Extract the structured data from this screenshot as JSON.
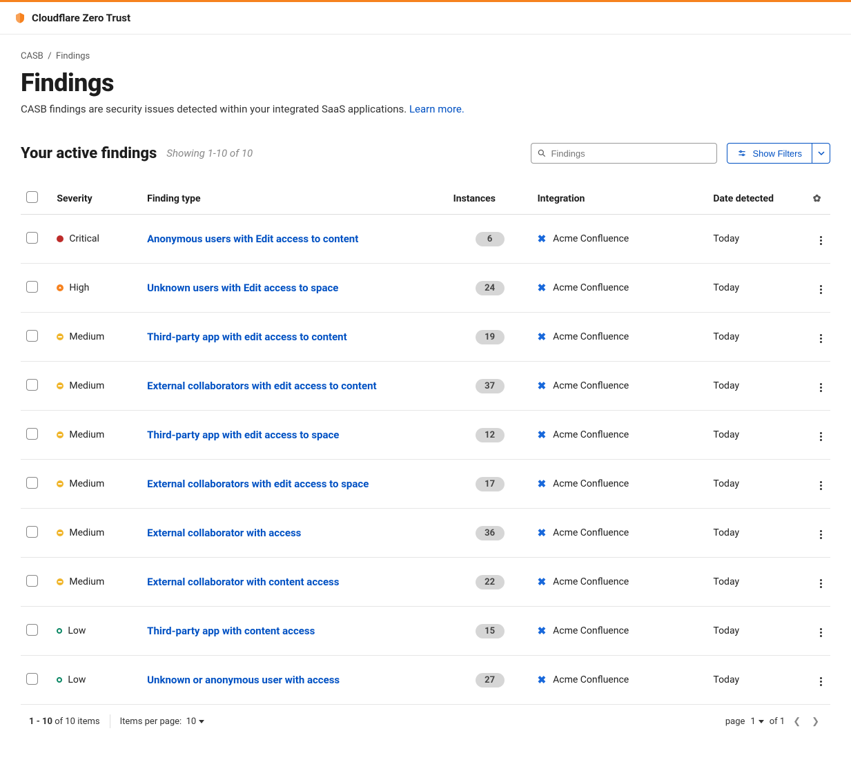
{
  "header": {
    "product": "Cloudflare Zero Trust"
  },
  "breadcrumb": {
    "root": "CASB",
    "sep": "/",
    "current": "Findings"
  },
  "page": {
    "title": "Findings",
    "description": "CASB findings are security issues detected within your integrated SaaS applications. ",
    "learn_more": "Learn more."
  },
  "subheader": {
    "title": "Your active findings",
    "showing": "Showing 1-10 of 10"
  },
  "search": {
    "placeholder": "Findings"
  },
  "filters": {
    "label": "Show Filters"
  },
  "columns": {
    "severity": "Severity",
    "type": "Finding type",
    "instances": "Instances",
    "integration": "Integration",
    "date": "Date detected"
  },
  "rows": [
    {
      "severity": "Critical",
      "sev_class": "sev-critical",
      "type": "Anonymous users with Edit access to content",
      "instances": "6",
      "integration": "Acme Confluence",
      "date": "Today"
    },
    {
      "severity": "High",
      "sev_class": "sev-high",
      "type": "Unknown users with Edit access to space",
      "instances": "24",
      "integration": "Acme Confluence",
      "date": "Today"
    },
    {
      "severity": "Medium",
      "sev_class": "sev-medium",
      "type": "Third-party app with edit access to content",
      "instances": "19",
      "integration": "Acme Confluence",
      "date": "Today"
    },
    {
      "severity": "Medium",
      "sev_class": "sev-medium",
      "type": "External collaborators with edit access to content",
      "instances": "37",
      "integration": "Acme Confluence",
      "date": "Today"
    },
    {
      "severity": "Medium",
      "sev_class": "sev-medium",
      "type": "Third-party app with edit access to space",
      "instances": "12",
      "integration": "Acme Confluence",
      "date": "Today"
    },
    {
      "severity": "Medium",
      "sev_class": "sev-medium",
      "type": "External collaborators with edit access to space",
      "instances": "17",
      "integration": "Acme Confluence",
      "date": "Today"
    },
    {
      "severity": "Medium",
      "sev_class": "sev-medium",
      "type": "External collaborator with access",
      "instances": "36",
      "integration": "Acme Confluence",
      "date": "Today"
    },
    {
      "severity": "Medium",
      "sev_class": "sev-medium",
      "type": "External collaborator with content access",
      "instances": "22",
      "integration": "Acme Confluence",
      "date": "Today"
    },
    {
      "severity": "Low",
      "sev_class": "sev-low",
      "type": "Third-party app with content access",
      "instances": "15",
      "integration": "Acme Confluence",
      "date": "Today"
    },
    {
      "severity": "Low",
      "sev_class": "sev-low",
      "type": "Unknown or anonymous user with access",
      "instances": "27",
      "integration": "Acme Confluence",
      "date": "Today"
    }
  ],
  "pager": {
    "range_bold": "1 - 10",
    "range_rest": " of 10 items",
    "per_page_label": "Items per page:",
    "per_page_value": "10",
    "page_label": "page",
    "page_current": "1",
    "page_of": "of 1"
  }
}
